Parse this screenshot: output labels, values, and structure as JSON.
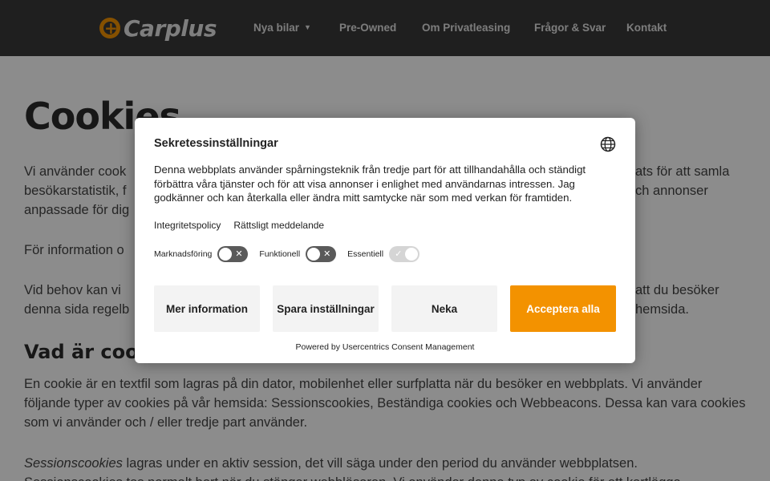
{
  "header": {
    "logo_text": "Carplus",
    "nav": [
      {
        "label": "Nya bilar",
        "has_dropdown": true
      },
      {
        "label": "Pre-Owned"
      },
      {
        "label": "Om Privatleasing"
      },
      {
        "label": "Frågor & Svar"
      },
      {
        "label": "Kontakt"
      }
    ]
  },
  "page": {
    "title": "Cookies",
    "para1": "Vi använder cookies för att förbättra din upplevelse av webbplatsen. Vi använder cookies på vår webbplats för att samla besökarstatistik, för att anpassa innehållet och visa information och annonser anpassade för dig.",
    "para1_line1": "Vi använder cook",
    "para1_line1_tail": "ats för att samla",
    "para1_line2": "besökarstatistik, f",
    "para1_line2_tail": "ch annonser",
    "para1_line3": "anpassade för dig",
    "para2_line1": "För information o",
    "para3_line1": "Vid behov kan vi",
    "para3_line1_tail": "att du besöker",
    "para3_line2": "denna sida regelb",
    "para3_line2_tail": "hemsida.",
    "h2": "Vad är coo",
    "para4": "En cookie är en textfil som lagras på din dator, mobilenhet eller surfplatta när du besöker en webbplats. Vi använder följande typer av cookies på vår hemsida: Sessionscookies, Beständiga cookies och Webbeacons. Dessa kan vara cookies som vi använder och / eller tredje part använder.",
    "para5_em": "Sessionscookies",
    "para5": " lagras under en aktiv session, det vill säga under den period du använder webbplatsen.",
    "para6": "Sessionscookies tas normalt bort när du stänger webbläsaren. Vi använder denna typ av cookie för att kartlägga"
  },
  "dialog": {
    "title": "Sekretessinställningar",
    "description": "Denna webbplats använder spårningsteknik från tredje part för att tillhandahålla och ständigt förbättra våra tjänster och för att visa annonser i enlighet med användarnas intressen. Jag godkänner och kan återkalla eller ändra mitt samtycke när som med verkan för framtiden.",
    "links": [
      "Integritetspolicy",
      "Rättsligt meddelande"
    ],
    "toggles": [
      {
        "label": "Marknadsföring",
        "state": "off"
      },
      {
        "label": "Funktionell",
        "state": "off"
      },
      {
        "label": "Essentiell",
        "state": "locked-on"
      }
    ],
    "buttons": {
      "more_info": "Mer information",
      "save": "Spara inställningar",
      "deny": "Neka",
      "accept": "Acceptera alla"
    },
    "powered_by": "Powered by Usercentrics Consent Management"
  },
  "colors": {
    "accent": "#f39200",
    "header_bg": "#3a3a3a"
  }
}
